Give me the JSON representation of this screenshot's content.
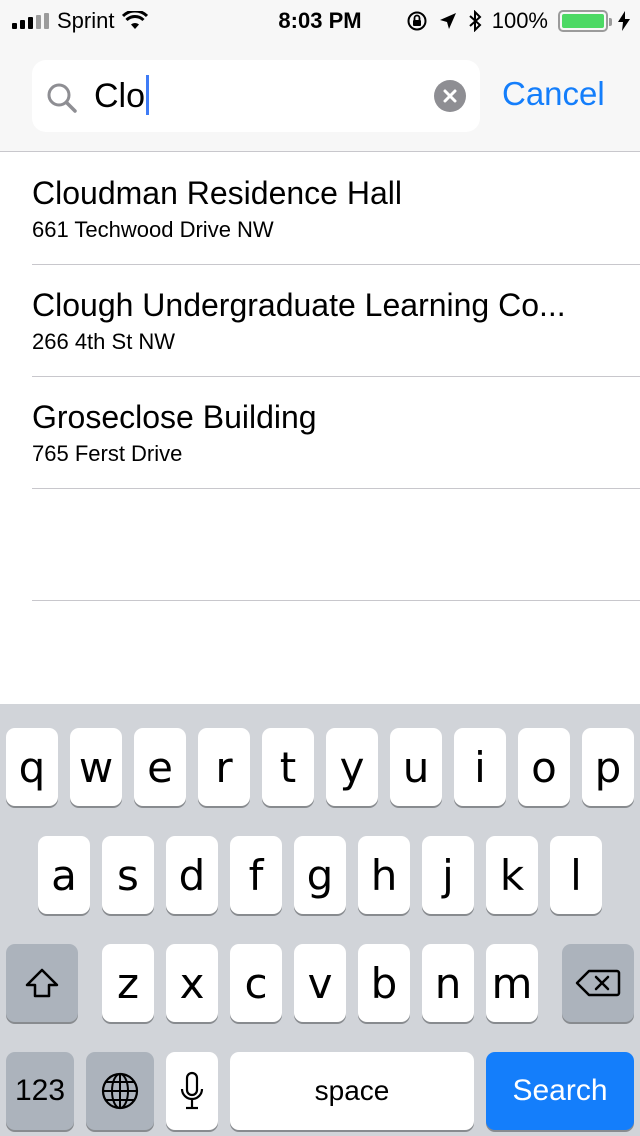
{
  "status_bar": {
    "carrier": "Sprint",
    "time": "8:03 PM",
    "battery_percent": "100%",
    "signal_bars_filled": 3,
    "signal_bars_total": 5,
    "battery_level": 1.0
  },
  "search": {
    "value": "Clo",
    "cancel_label": "Cancel"
  },
  "results": [
    {
      "title": "Cloudman Residence Hall",
      "address": "661 Techwood Drive NW"
    },
    {
      "title": "Clough Undergraduate Learning Co...",
      "address": "266 4th St NW"
    },
    {
      "title": "Groseclose Building",
      "address": "765 Ferst Drive"
    }
  ],
  "keyboard": {
    "row1": [
      "q",
      "w",
      "e",
      "r",
      "t",
      "y",
      "u",
      "i",
      "o",
      "p"
    ],
    "row2": [
      "a",
      "s",
      "d",
      "f",
      "g",
      "h",
      "j",
      "k",
      "l"
    ],
    "row3": [
      "z",
      "x",
      "c",
      "v",
      "b",
      "n",
      "m"
    ],
    "numbers_label": "123",
    "space_label": "space",
    "search_label": "Search"
  },
  "colors": {
    "accent": "#147efb",
    "battery": "#4cd964",
    "keyboard_bg": "#d1d4d9",
    "dark_key": "#acb3bc"
  }
}
